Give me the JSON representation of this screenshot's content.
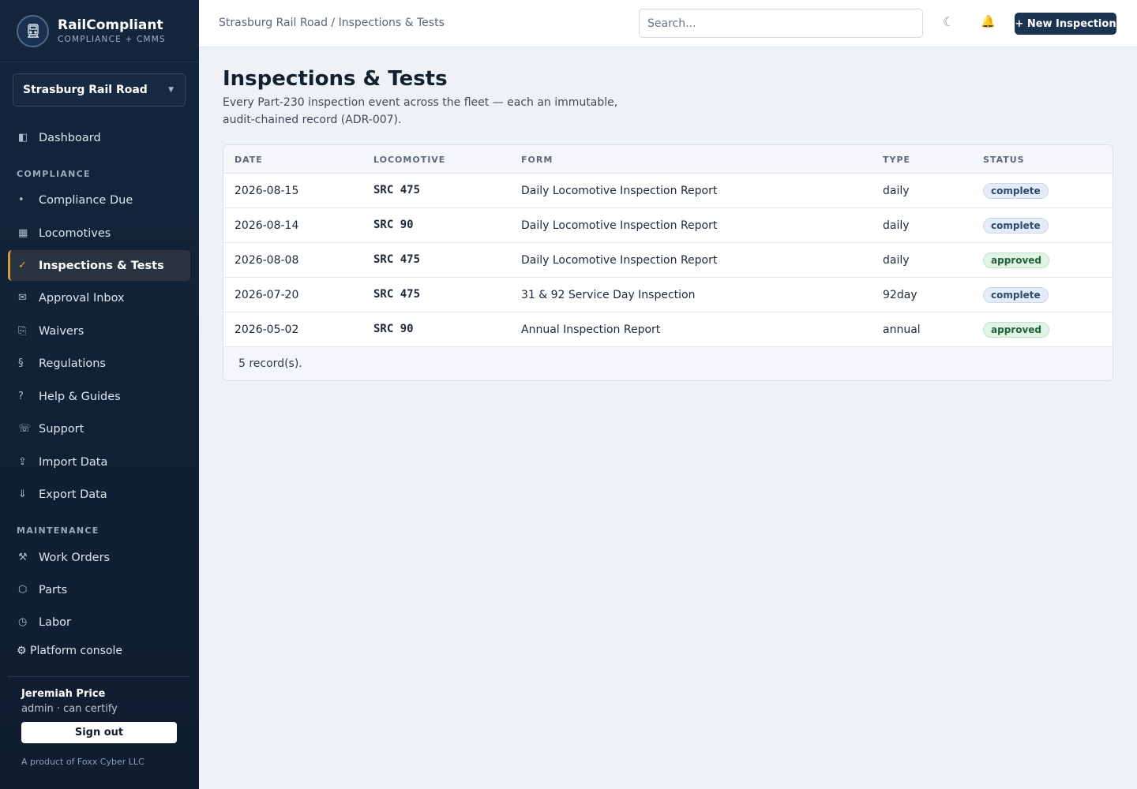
{
  "brand": {
    "name": "RailCompliant",
    "tagline": "COMPLIANCE + CMMS"
  },
  "org": {
    "selected": "Strasburg Rail Road"
  },
  "nav": {
    "dashboard": {
      "label": "Dashboard",
      "icon": "dashboard-icon"
    },
    "compliance_section": "COMPLIANCE",
    "compliance_items": [
      {
        "label": "Compliance Due",
        "icon": "dot-icon"
      },
      {
        "label": "Locomotives",
        "icon": "grid-icon"
      },
      {
        "label": "Inspections & Tests",
        "icon": "check-icon",
        "active": true
      },
      {
        "label": "Approval Inbox",
        "icon": "mail-icon"
      },
      {
        "label": "Waivers",
        "icon": "waiver-icon"
      },
      {
        "label": "Regulations",
        "icon": "section-icon"
      },
      {
        "label": "Help & Guides",
        "icon": "help-icon"
      },
      {
        "label": "Support",
        "icon": "phone-icon"
      },
      {
        "label": "Import Data",
        "icon": "upload-icon"
      },
      {
        "label": "Export Data",
        "icon": "download-icon"
      }
    ],
    "maintenance_section": "MAINTENANCE",
    "maintenance_items": [
      {
        "label": "Work Orders",
        "icon": "tools-icon"
      },
      {
        "label": "Parts",
        "icon": "hexagon-icon"
      },
      {
        "label": "Labor",
        "icon": "clock-icon"
      }
    ],
    "platform_console": "⚙ Platform console"
  },
  "user": {
    "name": "Jeremiah Price",
    "role": "admin · can certify",
    "signout_label": "Sign out",
    "product_note": "A product of Foxx Cyber LLC"
  },
  "topbar": {
    "breadcrumb": "Strasburg Rail Road / Inspections & Tests",
    "search_placeholder": "Search...",
    "new_button": "+ New Inspection"
  },
  "page": {
    "title": "Inspections & Tests",
    "subtitle": "Every Part-230 inspection event across the fleet — each an immutable, audit-chained record (ADR-007)."
  },
  "table": {
    "headers": {
      "date": "DATE",
      "locomotive": "LOCOMOTIVE",
      "form": "FORM",
      "type": "TYPE",
      "status": "STATUS"
    },
    "rows": [
      {
        "date": "2026-08-15",
        "locomotive": "SRC 475",
        "form": "Daily Locomotive Inspection Report",
        "type": "daily",
        "status": "complete"
      },
      {
        "date": "2026-08-14",
        "locomotive": "SRC 90",
        "form": "Daily Locomotive Inspection Report",
        "type": "daily",
        "status": "complete"
      },
      {
        "date": "2026-08-08",
        "locomotive": "SRC 475",
        "form": "Daily Locomotive Inspection Report",
        "type": "daily",
        "status": "approved"
      },
      {
        "date": "2026-07-20",
        "locomotive": "SRC 475",
        "form": "31 & 92 Service Day Inspection",
        "type": "92day",
        "status": "complete"
      },
      {
        "date": "2026-05-02",
        "locomotive": "SRC 90",
        "form": "Annual Inspection Report",
        "type": "annual",
        "status": "approved"
      }
    ],
    "footer": "5 record(s)."
  },
  "colors": {
    "sidebar_bg": "#13263d",
    "accent": "#d39a3a",
    "primary_button": "#1d3450",
    "complete_badge": "#e4edf7",
    "approved_badge": "#e1f3e6"
  }
}
